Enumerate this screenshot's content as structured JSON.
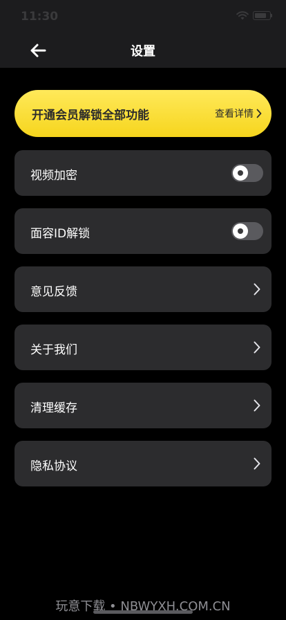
{
  "status_bar": {
    "time": "11:30"
  },
  "header": {
    "title": "设置",
    "back_icon": "arrow-left-icon"
  },
  "vip_banner": {
    "title": "开通会员解锁全部功能",
    "detail_label": "查看详情",
    "color": "#f6d51d"
  },
  "settings": {
    "video_encryption": {
      "label": "视频加密",
      "enabled": false
    },
    "face_id_unlock": {
      "label": "面容ID解锁",
      "enabled": false
    },
    "feedback": {
      "label": "意见反馈"
    },
    "about_us": {
      "label": "关于我们"
    },
    "clear_cache": {
      "label": "清理缓存"
    },
    "privacy_policy": {
      "label": "隐私协议"
    }
  },
  "watermark": "玩意下载 • NBWYXH.COM.CN"
}
